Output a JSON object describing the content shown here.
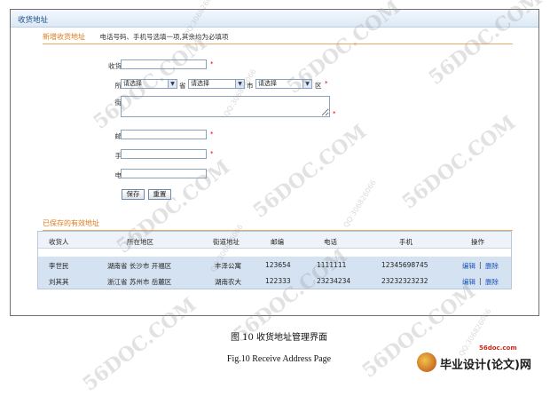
{
  "panel": {
    "title": "收货地址"
  },
  "new_section": {
    "title": "新增收货地址",
    "hint": "电话号码、手机号选填一项,其余均为必填项"
  },
  "form": {
    "name_label": "收货人姓名:",
    "region_label": "所在地区:",
    "street_label": "街道地址:",
    "zip_label": "邮政编码:",
    "mobile_label": "手机号码:",
    "phone_label": "电话号码:",
    "province_value": "请选择",
    "city_value": "请选择",
    "district_value": "请选择",
    "unit_province": "省",
    "unit_city": "市",
    "unit_district": "区",
    "required_mark": "*",
    "save_label": "保存",
    "reset_label": "重置"
  },
  "saved_section": {
    "title": "已保存的有效地址"
  },
  "table": {
    "columns": [
      "收货人",
      "所在地区",
      "街道地址",
      "邮编",
      "电话",
      "手机",
      "操作"
    ],
    "rows": [
      {
        "name": "李世民",
        "region": "湖南省 长沙市 开福区",
        "street": "丰泽公寓",
        "zip": "123654",
        "phone": "1111111",
        "mobile": "12345698745",
        "edit": "编辑",
        "sep": "|",
        "del": "删除"
      },
      {
        "name": "刘其其",
        "region": "浙江省 苏州市 岳麓区",
        "street": "湖南农大",
        "zip": "122333",
        "phone": "23234234",
        "mobile": "23232323232",
        "edit": "编辑",
        "sep": "|",
        "del": "删除"
      }
    ]
  },
  "caption": {
    "zh": "图 10 收货地址管理界面",
    "en": "Fig.10 Receive Address Page"
  },
  "watermark": {
    "site": "56DOC.COM",
    "qq": "QQ:306826066"
  },
  "brand": {
    "site": "56doc.com",
    "name": "毕业设计(论文)网"
  }
}
